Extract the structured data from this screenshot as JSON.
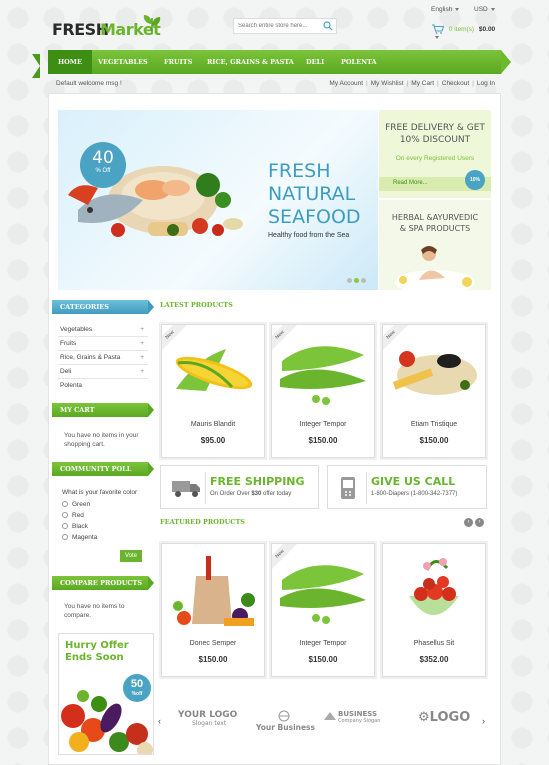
{
  "logo": {
    "word1": "FRESH",
    "word2": "Market"
  },
  "search": {
    "placeholder": "Search entire store here..."
  },
  "header": {
    "language": "English",
    "currency": "USD",
    "cart_items": "0 item(s)",
    "cart_total": "$0.00"
  },
  "nav": {
    "items": [
      "HOME",
      "VEGETABLES",
      "FRUITS",
      "RICE, GRAINS & PASTA",
      "DELI",
      "POLENTA"
    ]
  },
  "toplinks": {
    "welcome": "Default welcome msg !",
    "links": [
      "My Account",
      "My Wishlist",
      "My Cart",
      "Checkout",
      "Log In"
    ]
  },
  "hero": {
    "badge_num": "40",
    "badge_label": "% Off",
    "headline": [
      "FRESH",
      "NATURAL",
      "SEAFOOD"
    ],
    "subline": "Healthy food from the Sea"
  },
  "side_banner_1": {
    "title": [
      "FREE DELIVERY & GET",
      "10% DISCOUNT"
    ],
    "subtitle": "On every Registered Users",
    "more": "Read More...",
    "badge": "10%"
  },
  "side_banner_2": {
    "title": [
      "HERBAL &AYURVEDIC",
      "& SPA PRODUCTS"
    ]
  },
  "sidebar": {
    "categories_title": "CATEGORIES",
    "categories": [
      "Vegetables",
      "Fruits",
      "Rice, Grains & Pasta",
      "Deli",
      "Polenta"
    ],
    "cart_title": "MY CART",
    "cart_text": [
      "You have no items in your",
      "shopping cart."
    ],
    "poll_title": "COMMUNITY POLL",
    "poll_question": "What is your favorite color",
    "poll_options": [
      "Green",
      "Red",
      "Black",
      "Magenta"
    ],
    "vote": "Vote",
    "compare_title": "COMPARE PRODUCTS",
    "compare_text": [
      "You have no items to",
      "compare."
    ],
    "offer": [
      "Hurry Offer",
      "Ends Soon"
    ],
    "offer_badge": "50",
    "offer_badge_sub": "%off"
  },
  "latest": {
    "title": "LATEST PRODUCTS",
    "new_label": "New",
    "products": [
      {
        "name": "Mauris Blandit",
        "price": "$95.00"
      },
      {
        "name": "Integer Tempor",
        "price": "$150.00"
      },
      {
        "name": "Etiam Tristique",
        "price": "$150.00"
      }
    ]
  },
  "promos": {
    "shipping_title": "FREE SHIPPING",
    "shipping_pre": "On Order Over ",
    "shipping_amt": "$30",
    "shipping_post": " offer today",
    "call_title": "GIVE US CALL",
    "call_text": "1-800-Diapers (1-800-342-7377)"
  },
  "featured": {
    "title": "FEATURED PRODUCTS",
    "new_label": "New",
    "products": [
      {
        "name": "Donec Semper",
        "price": "$150.00"
      },
      {
        "name": "Integer Tempor",
        "price": "$150.00"
      },
      {
        "name": "Phasellus Sit",
        "price": "$352.00"
      }
    ]
  },
  "brands": {
    "b1": "YOUR LOGO",
    "b1_sub": "Slogan text",
    "b2": "Your Business",
    "b3": "BUSINESS",
    "b3_sub": "Company Slogan",
    "b4": "LOGO"
  },
  "colors": {
    "green": "#6bb52e",
    "dark_green": "#3f8e14",
    "blue": "#4aa3c3"
  }
}
